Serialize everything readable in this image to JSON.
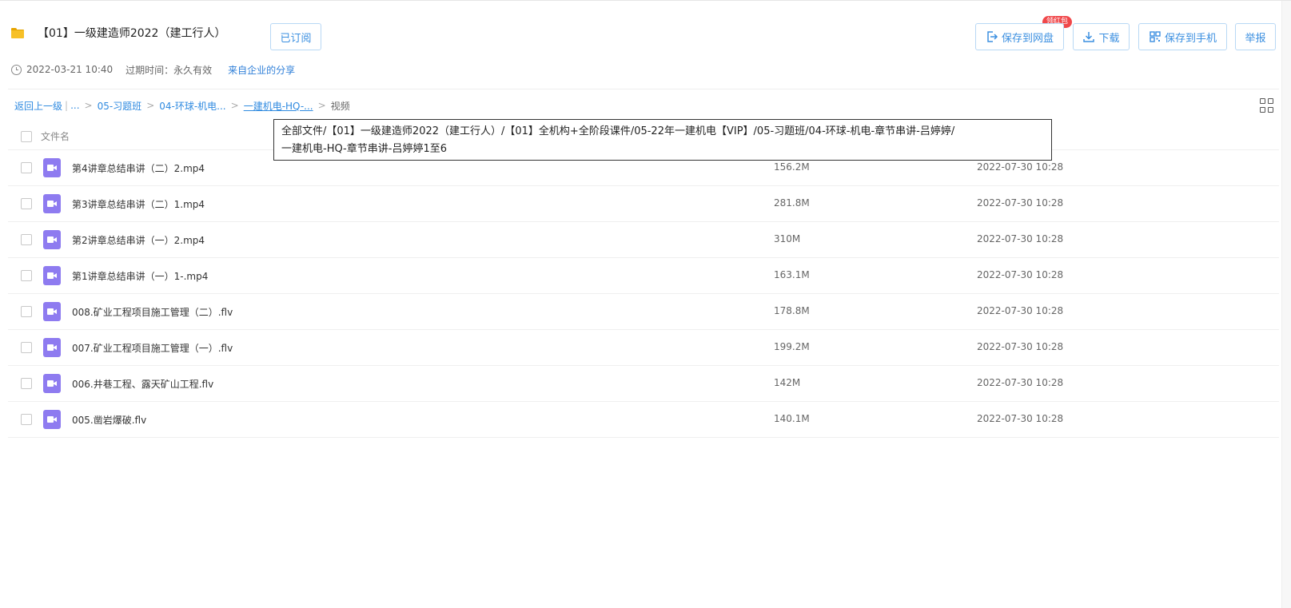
{
  "header": {
    "title": "【01】一级建造师2022（建工行人）",
    "subscribed_label": "已订阅"
  },
  "meta": {
    "date": "2022-03-21 10:40",
    "expire": "过期时间：永久有效",
    "source_link": "来自企业的分享"
  },
  "actions": {
    "save_disk": "保存到网盘",
    "badge": "领红包",
    "download": "下载",
    "save_phone": "保存到手机",
    "report": "举报"
  },
  "breadcrumb": {
    "back": "返回上一级",
    "ellipsis": "...",
    "item1": "05-习题班",
    "item2": "04-环球-机电...",
    "item3": "一建机电-HQ-...",
    "current": "视频"
  },
  "table": {
    "col_name": "文件名"
  },
  "tooltip": {
    "line1": "全部文件/【01】一级建造师2022（建工行人）/【01】全机构+全阶段课件/05-22年一建机电【VIP】/05-习题班/04-环球-机电-章节串讲-吕婷婷/",
    "line2": "一建机电-HQ-章节串讲-吕婷婷1至6"
  },
  "files": [
    {
      "name": "第4讲章总结串讲（二）2.mp4",
      "size": "156.2M",
      "time": "2022-07-30 10:28"
    },
    {
      "name": "第3讲章总结串讲（二）1.mp4",
      "size": "281.8M",
      "time": "2022-07-30 10:28"
    },
    {
      "name": "第2讲章总结串讲（一）2.mp4",
      "size": "310M",
      "time": "2022-07-30 10:28"
    },
    {
      "name": "第1讲章总结串讲（一）1-.mp4",
      "size": "163.1M",
      "time": "2022-07-30 10:28"
    },
    {
      "name": "008.矿业工程项目施工管理（二）.flv",
      "size": "178.8M",
      "time": "2022-07-30 10:28"
    },
    {
      "name": "007.矿业工程项目施工管理（一）.flv",
      "size": "199.2M",
      "time": "2022-07-30 10:28"
    },
    {
      "name": "006.井巷工程、露天矿山工程.flv",
      "size": "142M",
      "time": "2022-07-30 10:28"
    },
    {
      "name": "005.凿岩爆破.flv",
      "size": "140.1M",
      "time": "2022-07-30 10:28"
    }
  ],
  "colors": {
    "accent": "#3b8fe0",
    "video_icon": "#8e7bf0",
    "badge": "#f0474a",
    "folder": "#f7c026"
  },
  "icons": {
    "folder": "folder-icon",
    "clock": "clock-icon",
    "save": "save-to-disk-icon",
    "download": "download-icon",
    "qrcode": "qrcode-icon",
    "grid": "grid-view-icon",
    "video": "video-file-icon"
  }
}
